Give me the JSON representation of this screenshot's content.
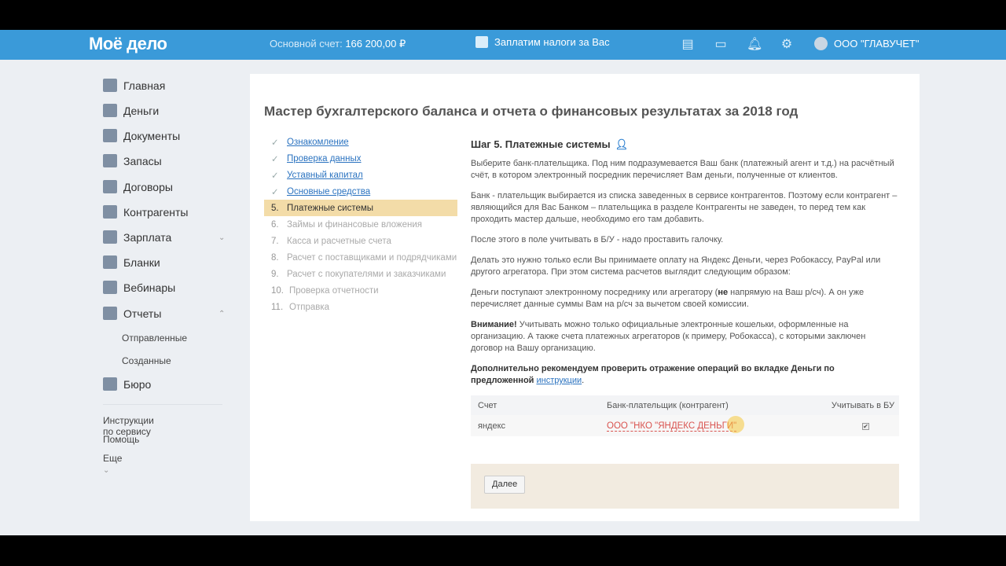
{
  "header": {
    "logo": "Моё дело",
    "account_label": "Основной счет:",
    "account_value": "166 200,00 ₽",
    "tax_label": "Заплатим налоги за Вас",
    "org": "ООО \"ГЛАВУЧЕТ\""
  },
  "sidebar": {
    "items": [
      {
        "label": "Главная"
      },
      {
        "label": "Деньги"
      },
      {
        "label": "Документы"
      },
      {
        "label": "Запасы"
      },
      {
        "label": "Договоры"
      },
      {
        "label": "Контрагенты"
      },
      {
        "label": "Зарплата"
      },
      {
        "label": "Бланки"
      },
      {
        "label": "Вебинары"
      },
      {
        "label": "Отчеты"
      },
      {
        "label": "Бюро"
      }
    ],
    "sub_items": [
      "Отправленные",
      "Созданные"
    ],
    "links": [
      "Инструкции по сервису",
      "Помощь",
      "Еще"
    ]
  },
  "page": {
    "title": "Мастер бухгалтерского баланса и отчета о финансовых результатах за 2018 год",
    "steps": [
      {
        "n": "",
        "label": "Ознакомление"
      },
      {
        "n": "",
        "label": "Проверка данных"
      },
      {
        "n": "",
        "label": "Уставный капитал"
      },
      {
        "n": "",
        "label": "Основные средства"
      },
      {
        "n": "5.",
        "label": "Платежные системы"
      },
      {
        "n": "6.",
        "label": "Займы и финансовые вложения"
      },
      {
        "n": "7.",
        "label": "Касса и расчетные счета"
      },
      {
        "n": "8.",
        "label": "Расчет с поставщиками и подрядчиками"
      },
      {
        "n": "9.",
        "label": "Расчет с покупателями и заказчиками"
      },
      {
        "n": "10.",
        "label": "Проверка отчетности"
      },
      {
        "n": "11.",
        "label": "Отправка"
      }
    ],
    "step_title": "Шаг 5. Платежные системы",
    "p1": "Выберите банк-плательщика. Под ним подразумевается Ваш банк (платежный агент и т.д.) на расчётный счёт, в котором электронный посредник перечисляет Вам деньги, полученные от клиентов.",
    "p2": "Банк - плательщик выбирается из списка заведенных в сервисе контрагентов. Поэтому если контрагент – являющийся для Вас Банком – плательщика в разделе Контрагенты не заведен, то перед тем как проходить мастер дальше, необходимо его там добавить.",
    "p3": "После этого в поле учитывать в Б/У - надо проставить галочку.",
    "p4": "Делать это нужно только если Вы принимаете оплату на Яндекс Деньги, через Робокассу, PayPal или другого агрегатора. При этом система расчетов выглядит следующим образом:",
    "p5a": "Деньги поступают электронному посреднику или агрегатору (",
    "p5b": "не",
    "p5c": " напрямую на Ваш р/сч). А он уже перечисляет данные суммы Вам на р/сч за вычетом своей комиссии.",
    "p6a": "Внимание!",
    "p6b": " Учитывать можно только официальные электронные кошельки, оформленные на организацию. А также счета платежных агрегаторов (к примеру, Робокасса), с которыми заключен договор на Вашу организацию.",
    "p7a": "Дополнительно рекомендуем проверить отражение операций во вкладке Деньги по предложенной",
    "p7link": "инструкции",
    "p7end": ".",
    "table": {
      "headers": [
        "Счет",
        "Банк-плательщик (контрагент)",
        "Учитывать в БУ"
      ],
      "rows": [
        {
          "account": "яндекс",
          "bank": "ООО \"НКО \"ЯНДЕКС ДЕНЬГИ\"",
          "checked": true
        }
      ]
    },
    "next_label": "Далее"
  }
}
